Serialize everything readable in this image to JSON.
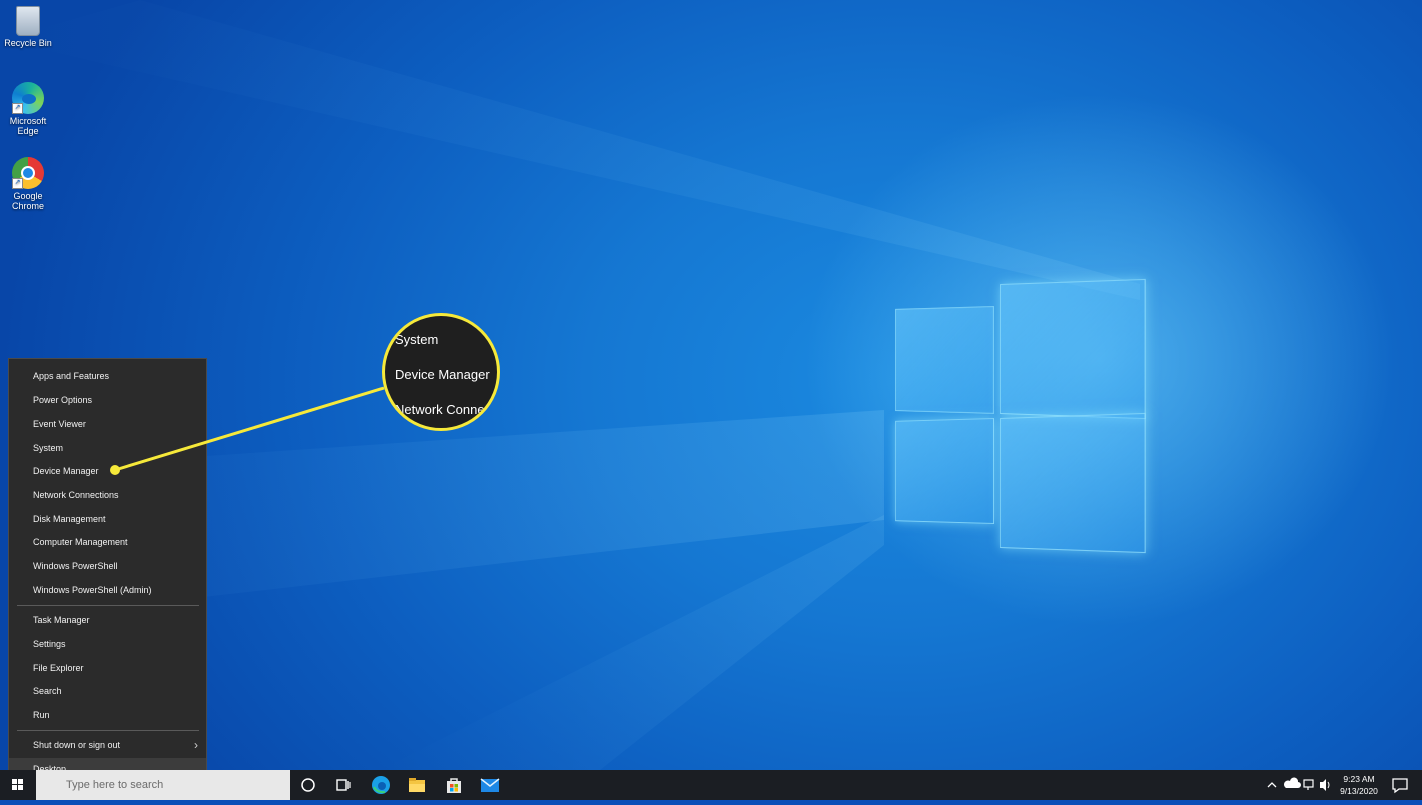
{
  "desktop": {
    "icons": [
      {
        "label": "Recycle Bin"
      },
      {
        "label": "Microsoft Edge"
      },
      {
        "label": "Google Chrome"
      }
    ]
  },
  "winx_menu": {
    "group1": [
      "Apps and Features",
      "Power Options",
      "Event Viewer",
      "System",
      "Device Manager",
      "Network Connections",
      "Disk Management",
      "Computer Management",
      "Windows PowerShell",
      "Windows PowerShell (Admin)"
    ],
    "group2": [
      "Task Manager",
      "Settings",
      "File Explorer",
      "Search",
      "Run"
    ],
    "group3": [
      "Shut down or sign out",
      "Desktop"
    ]
  },
  "callout": {
    "lines": [
      "System",
      "Device Manager",
      "Network Conne"
    ],
    "color": "#f6e93a"
  },
  "taskbar": {
    "search_placeholder": "Type here to search",
    "clock_time": "9:23 AM",
    "clock_date": "9/13/2020"
  },
  "colors": {
    "accent": "#0d5fc1",
    "menu_bg": "#2b2b2b",
    "taskbar_bg": "#1b1e23"
  }
}
